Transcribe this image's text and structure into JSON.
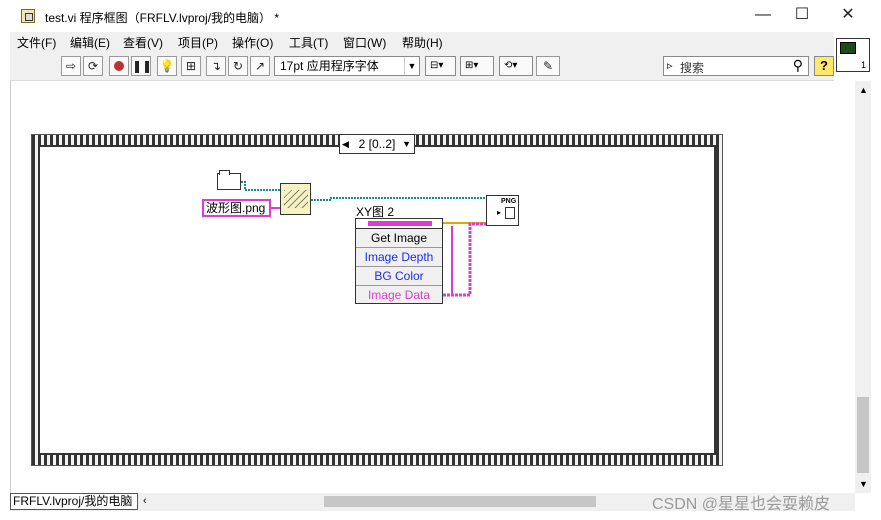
{
  "window": {
    "title": "test.vi 程序框图（FRFLV.lvproj/我的电脑） *",
    "minimize": "—",
    "maximize": "☐",
    "close": "✕"
  },
  "menu": [
    "文件(F)",
    "编辑(E)",
    "查看(V)",
    "项目(P)",
    "操作(O)",
    "工具(T)",
    "窗口(W)",
    "帮助(H)"
  ],
  "toolbar": {
    "font": "17pt 应用程序字体",
    "search_placeholder": "搜索",
    "help": "?"
  },
  "vi_icon_number": "1",
  "diagram": {
    "sequence_selector": "2 [0..2]",
    "file_constant": "波形图.png",
    "property_label": "XY图 2",
    "properties": [
      "Get Image",
      "Image Depth",
      "BG Color",
      "Image Data"
    ],
    "png_node_label": "PNG"
  },
  "status": {
    "path": "FRFLV.lvproj/我的电脑"
  },
  "watermark": "CSDN @星星也会耍赖皮",
  "colors": {
    "path_wire": "#1a8a8a",
    "image_wire": "#e03ad2",
    "number_wire": "#d6b000"
  }
}
